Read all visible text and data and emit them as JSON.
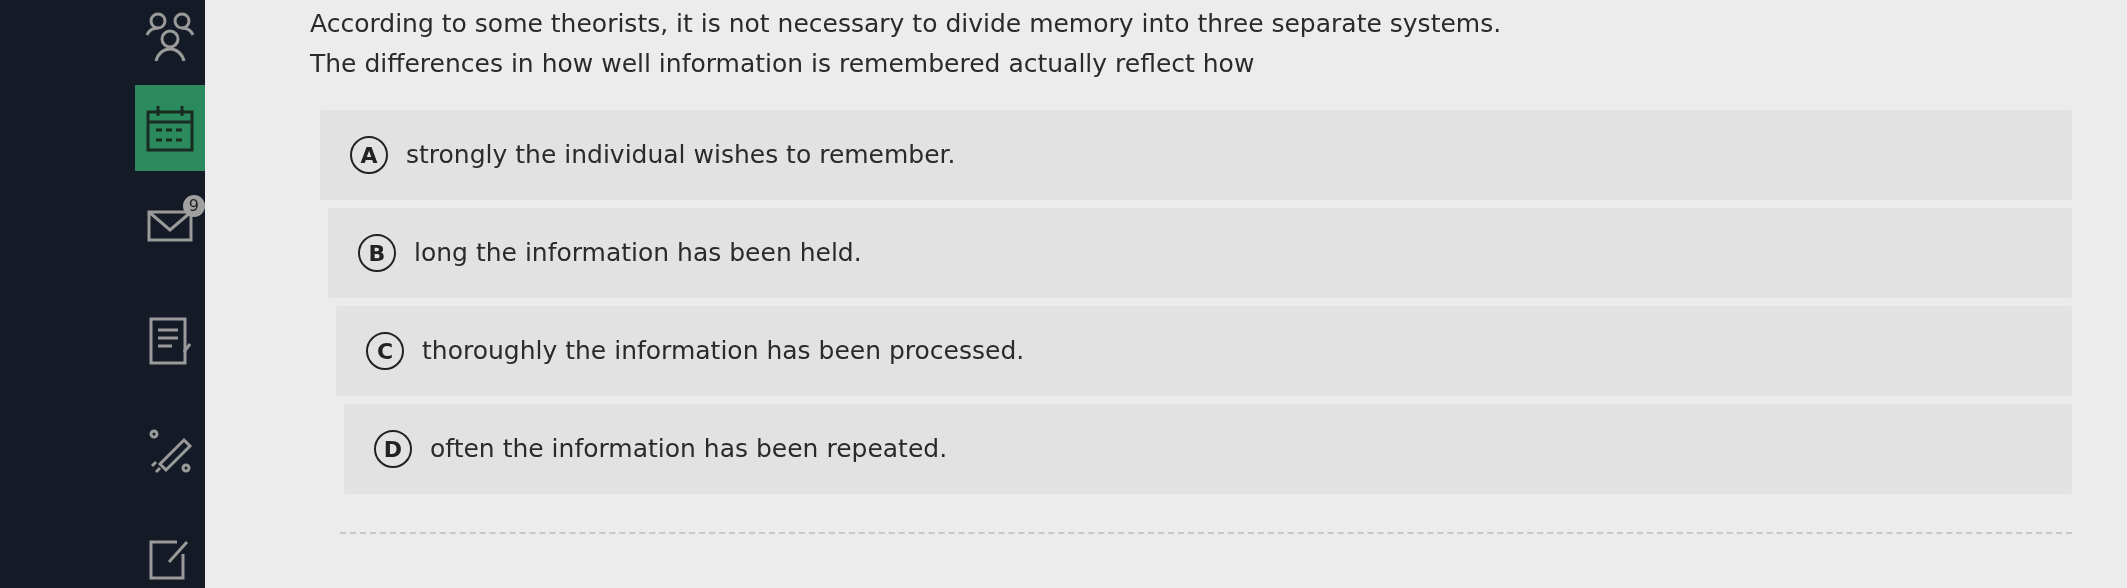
{
  "sidebar": {
    "items": [
      {
        "kind": "people",
        "selected": false
      },
      {
        "kind": "calendar",
        "selected": true
      },
      {
        "kind": "mail",
        "selected": false,
        "badge": "9"
      },
      {
        "kind": "document",
        "selected": false
      },
      {
        "kind": "pencil",
        "selected": false
      },
      {
        "kind": "edit",
        "selected": false
      }
    ]
  },
  "question": "According to some theorists, it is not necessary to divide memory into three separate systems. The differences in how well information is remembered actually reflect how",
  "options": [
    {
      "letter": "A",
      "text": "strongly the individual wishes to remember.",
      "selected": false
    },
    {
      "letter": "B",
      "text": "long the information has been held.",
      "selected": false
    },
    {
      "letter": "C",
      "text": "thoroughly the information has been processed.",
      "selected": false
    },
    {
      "letter": "D",
      "text": "often the information has been repeated.",
      "selected": false
    }
  ]
}
